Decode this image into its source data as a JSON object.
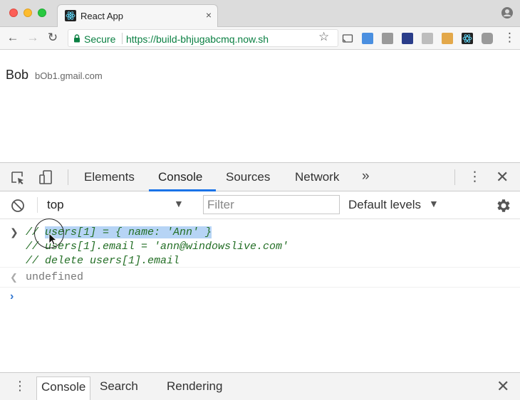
{
  "browser": {
    "tab_title": "React App",
    "tab_close": "×",
    "secure_label": "Secure",
    "url": "https://build-bhjugabcmq.now.sh"
  },
  "page": {
    "user_name": "Bob",
    "user_email": "bOb1.gmail.com"
  },
  "devtools": {
    "tabs": [
      "Elements",
      "Console",
      "Sources",
      "Network"
    ],
    "active_tab": "Console",
    "more_tabs": "»",
    "context": "top",
    "filter_placeholder": "Filter",
    "levels": "Default levels",
    "console": {
      "input_lines": [
        "// users[1] = { name: 'Ann' }",
        "// users[1].email = 'ann@windowslive.com'",
        "// delete users[1].email"
      ],
      "highlighted_text": "users[1] = { name: 'Ann' }",
      "result": "undefined"
    },
    "drawer_tabs": [
      "Console",
      "Search",
      "Rendering"
    ],
    "drawer_active": "Console"
  }
}
